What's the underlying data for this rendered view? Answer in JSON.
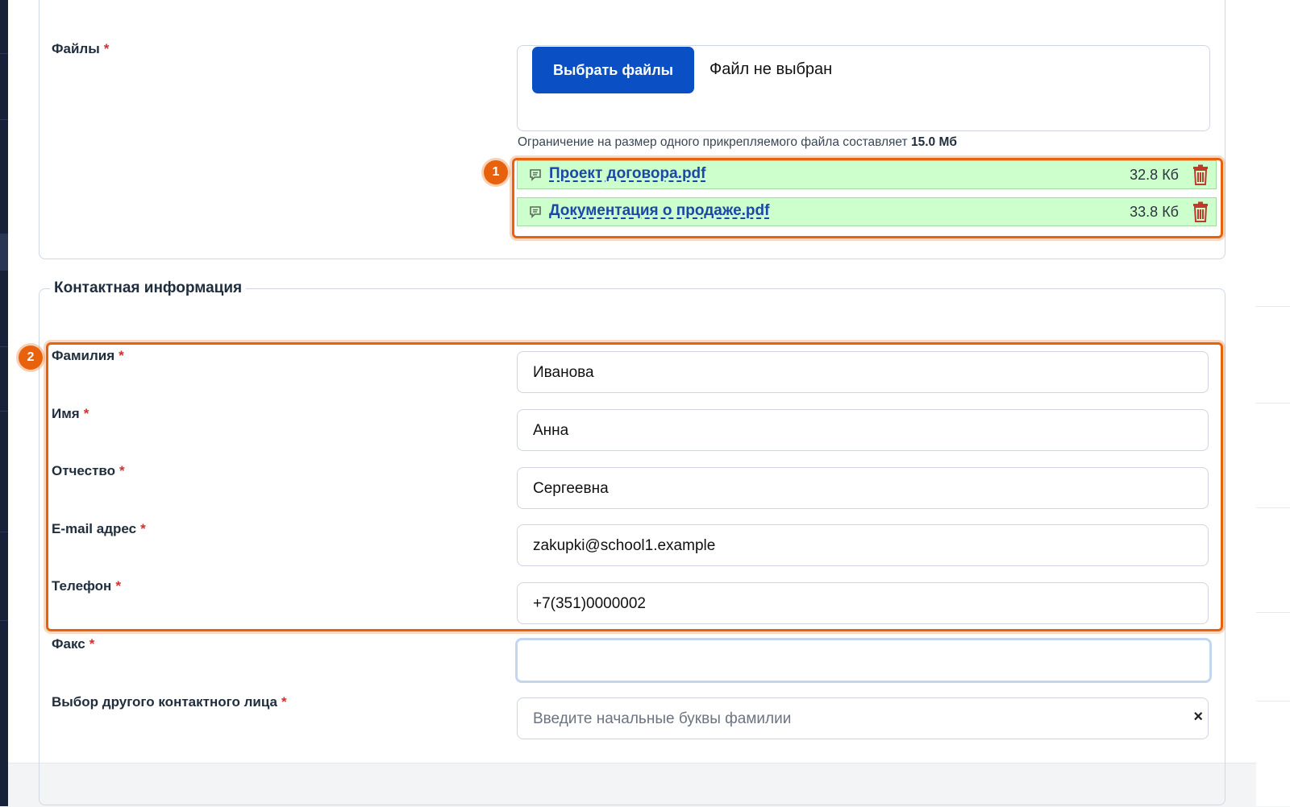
{
  "files_section": {
    "label": "Файлы",
    "required_mark": "*",
    "choose_button": "Выбрать файлы",
    "no_file_text": "Файл не выбран",
    "limit_text": "Ограничение на размер одного прикрепляемого файла составляет",
    "limit_value": "15.0 Мб",
    "attached": [
      {
        "name": "Проект договора.pdf",
        "size": "32.8 Кб"
      },
      {
        "name": "Документация о продаже.pdf",
        "size": "33.8 Кб"
      }
    ]
  },
  "contact_section": {
    "legend": "Контактная информация",
    "fields": [
      {
        "label": "Фамилия",
        "value": "Иванова"
      },
      {
        "label": "Имя",
        "value": "Анна"
      },
      {
        "label": "Отчество",
        "value": "Сергеевна"
      },
      {
        "label": "E-mail адрес",
        "value": "zakupki@school1.example"
      },
      {
        "label": "Телефон",
        "value": "+7(351)0000002"
      },
      {
        "label": "Факс",
        "value": ""
      }
    ],
    "other_contact": {
      "label": "Выбор другого контактного лица",
      "placeholder": "Введите начальные буквы фамилии",
      "clear_glyph": "×"
    }
  },
  "annotations": [
    {
      "number": "1"
    },
    {
      "number": "2"
    }
  ],
  "colors": {
    "accent_button": "#0a4fc4",
    "highlight": "#e8620e",
    "attached_bg": "#ccffcc",
    "required": "#d32f2f",
    "link": "#1b47a8"
  }
}
